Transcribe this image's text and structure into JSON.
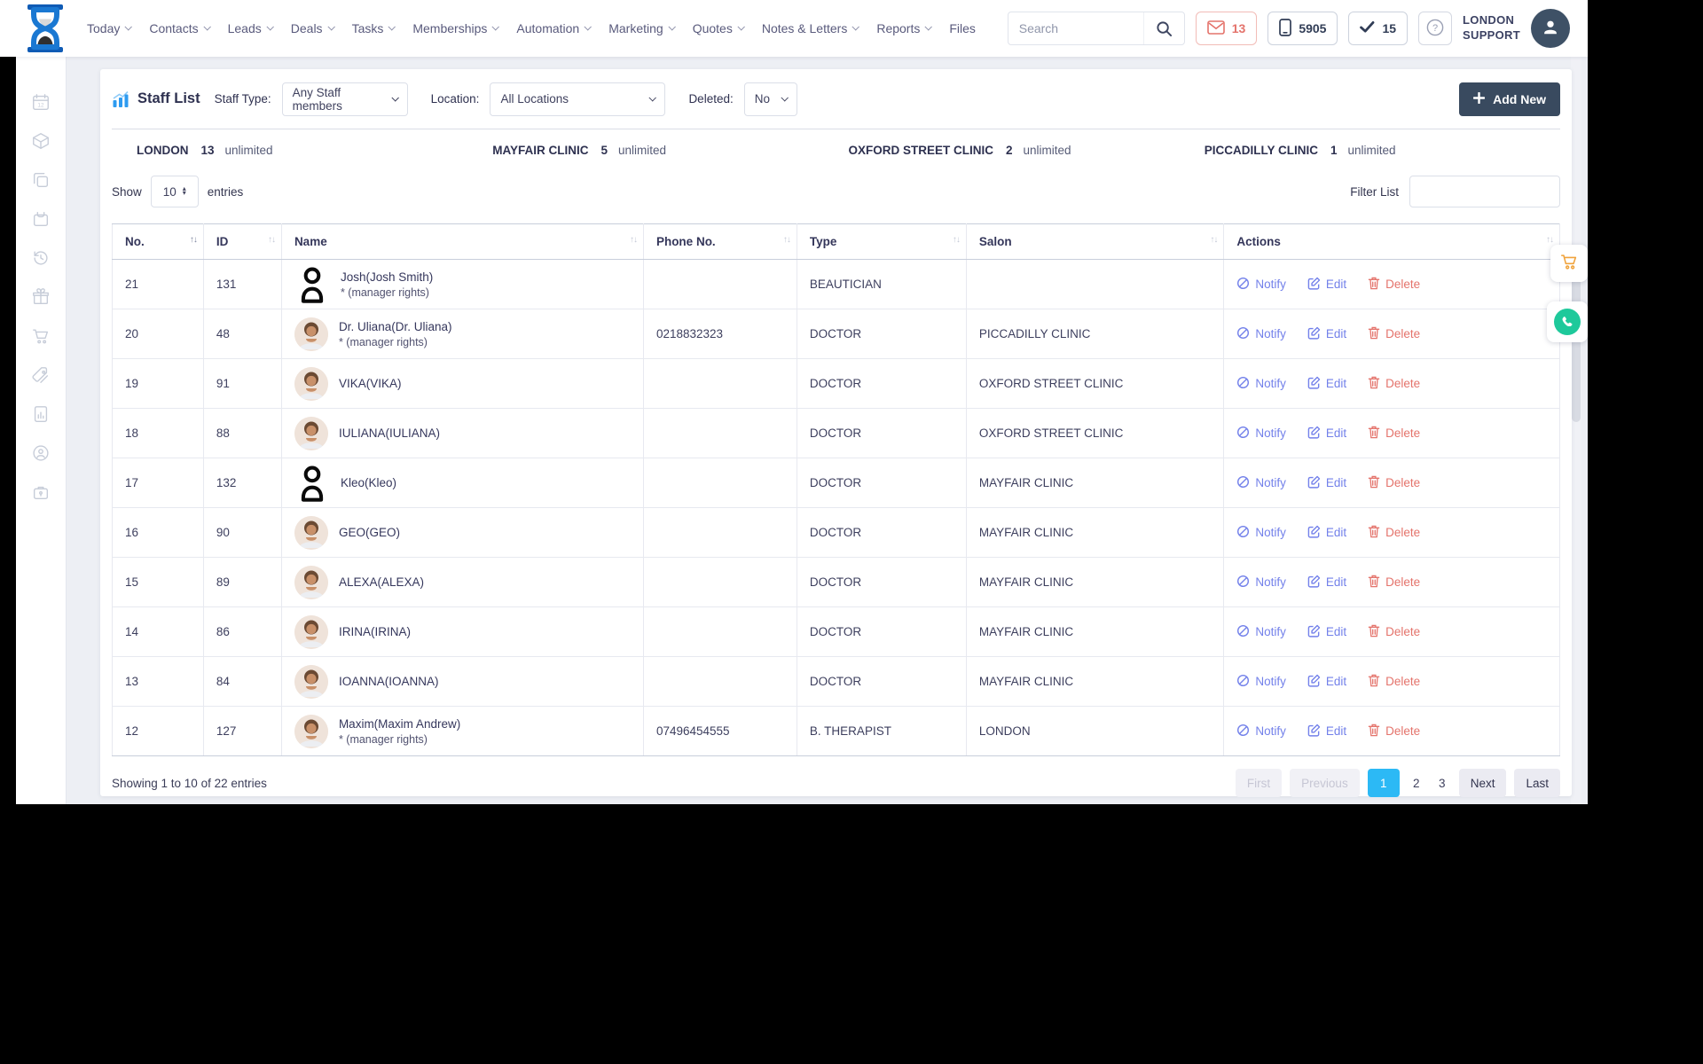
{
  "header": {
    "nav": [
      {
        "label": "Today",
        "chevron": true
      },
      {
        "label": "Contacts",
        "chevron": true
      },
      {
        "label": "Leads",
        "chevron": true
      },
      {
        "label": "Deals",
        "chevron": true
      },
      {
        "label": "Tasks",
        "chevron": true
      },
      {
        "label": "Memberships",
        "chevron": true
      },
      {
        "label": "Automation",
        "chevron": true
      },
      {
        "label": "Marketing",
        "chevron": true
      },
      {
        "label": "Quotes",
        "chevron": true
      },
      {
        "label": "Notes & Letters",
        "chevron": true
      },
      {
        "label": "Reports",
        "chevron": true
      },
      {
        "label": "Files",
        "chevron": false
      }
    ],
    "search_placeholder": "Search",
    "badges": {
      "messages": "13",
      "phone": "5905",
      "tasks": "15"
    },
    "user": {
      "line1": "LONDON",
      "line2": "SUPPORT"
    }
  },
  "sidebar": {
    "icons": [
      "calendar-icon",
      "package-icon",
      "copy-icon",
      "basket-icon",
      "history-icon",
      "gift-icon",
      "cart-icon",
      "tickets-icon",
      "report-icon",
      "user-status-icon",
      "lock-icon"
    ]
  },
  "page": {
    "title": "Staff List",
    "filters": {
      "staff_type_label": "Staff Type:",
      "staff_type_value": "Any Staff members",
      "location_label": "Location:",
      "location_value": "All Locations",
      "deleted_label": "Deleted:",
      "deleted_value": "No"
    },
    "add_new_label": "Add New",
    "stats": [
      {
        "name": "LONDON",
        "count": "13",
        "limit": "unlimited"
      },
      {
        "name": "MAYFAIR CLINIC",
        "count": "5",
        "limit": "unlimited"
      },
      {
        "name": "OXFORD STREET CLINIC",
        "count": "2",
        "limit": "unlimited"
      },
      {
        "name": "PICCADILLY CLINIC",
        "count": "1",
        "limit": "unlimited"
      }
    ],
    "show_label": "Show",
    "show_value": "10",
    "entries_label": "entries",
    "filter_label": "Filter List",
    "filter_value": "",
    "table": {
      "columns": [
        {
          "label": "No.",
          "sorted": true
        },
        {
          "label": "ID",
          "sorted": false
        },
        {
          "label": "Name",
          "sorted": false
        },
        {
          "label": "Phone No.",
          "sorted": false
        },
        {
          "label": "Type",
          "sorted": false
        },
        {
          "label": "Salon",
          "sorted": false
        },
        {
          "label": "Actions",
          "sorted": false
        }
      ],
      "actions": {
        "notify": "Notify",
        "edit": "Edit",
        "delete": "Delete"
      },
      "rows": [
        {
          "no": "21",
          "id": "131",
          "name": "Josh(Josh Smith)",
          "manager": "* (manager rights)",
          "phone": "",
          "type": "BEAUTICIAN",
          "salon": "",
          "avatar": "glyph"
        },
        {
          "no": "20",
          "id": "48",
          "name": "Dr. Uliana(Dr. Uliana)",
          "manager": "* (manager rights)",
          "phone": "0218832323",
          "type": "DOCTOR",
          "salon": "PICCADILLY CLINIC",
          "avatar": "photo"
        },
        {
          "no": "19",
          "id": "91",
          "name": "VIKA(VIKA)",
          "manager": "",
          "phone": "",
          "type": "DOCTOR",
          "salon": "OXFORD STREET CLINIC",
          "avatar": "photo"
        },
        {
          "no": "18",
          "id": "88",
          "name": "IULIANA(IULIANA)",
          "manager": "",
          "phone": "",
          "type": "DOCTOR",
          "salon": "OXFORD STREET CLINIC",
          "avatar": "photo"
        },
        {
          "no": "17",
          "id": "132",
          "name": "Kleo(Kleo)",
          "manager": "",
          "phone": "",
          "type": "DOCTOR",
          "salon": "MAYFAIR CLINIC",
          "avatar": "glyph"
        },
        {
          "no": "16",
          "id": "90",
          "name": "GEO(GEO)",
          "manager": "",
          "phone": "",
          "type": "DOCTOR",
          "salon": "MAYFAIR CLINIC",
          "avatar": "photo"
        },
        {
          "no": "15",
          "id": "89",
          "name": "ALEXA(ALEXA)",
          "manager": "",
          "phone": "",
          "type": "DOCTOR",
          "salon": "MAYFAIR CLINIC",
          "avatar": "photo"
        },
        {
          "no": "14",
          "id": "86",
          "name": "IRINA(IRINA)",
          "manager": "",
          "phone": "",
          "type": "DOCTOR",
          "salon": "MAYFAIR CLINIC",
          "avatar": "photo"
        },
        {
          "no": "13",
          "id": "84",
          "name": "IOANNA(IOANNA)",
          "manager": "",
          "phone": "",
          "type": "DOCTOR",
          "salon": "MAYFAIR CLINIC",
          "avatar": "photo"
        },
        {
          "no": "12",
          "id": "127",
          "name": "Maxim(Maxim Andrew)",
          "manager": "* (manager rights)",
          "phone": "07496454555",
          "type": "B. THERAPIST",
          "salon": "LONDON",
          "avatar": "photo"
        }
      ]
    },
    "footer": {
      "showing": "Showing 1 to 10 of 22 entries",
      "pagination": [
        {
          "label": "First",
          "state": "disabled"
        },
        {
          "label": "Previous",
          "state": "disabled"
        },
        {
          "label": "1",
          "state": "active"
        },
        {
          "label": "2",
          "state": "page"
        },
        {
          "label": "3",
          "state": "page"
        },
        {
          "label": "Next",
          "state": "btn"
        },
        {
          "label": "Last",
          "state": "btn"
        }
      ]
    }
  },
  "colors": {
    "accent": "#2cb9f5",
    "link": "#7381ea",
    "danger": "#e4736b",
    "dark_button": "#394a5f",
    "nav_text": "#595a7c",
    "brand_dark": "#0f5bb5",
    "brand_light": "#1a78d2",
    "teal": "#1ec99b",
    "orange": "#f0a33c",
    "sidebar_icon": "#c6ccd8",
    "page_bg": "#edeff4"
  }
}
